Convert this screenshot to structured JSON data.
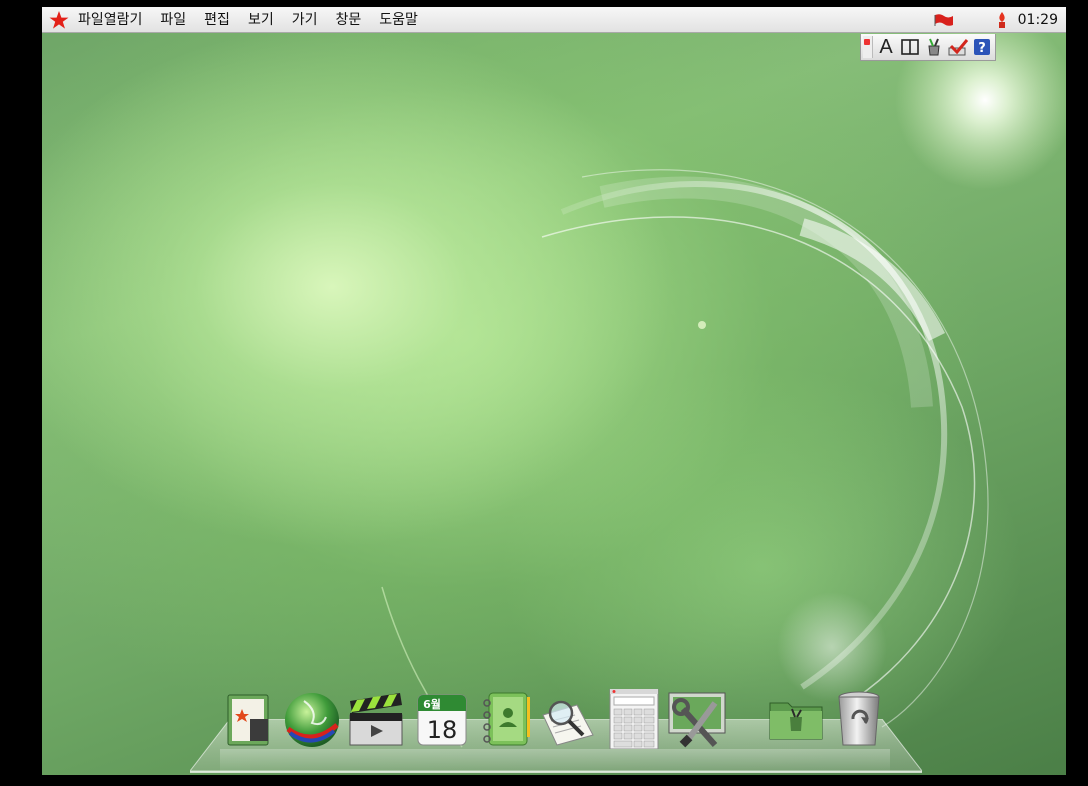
{
  "menubar": {
    "items": [
      "파일열람기",
      "파일",
      "편집",
      "보기",
      "가기",
      "창문",
      "도움말"
    ],
    "clock": "01:29",
    "star_color": "#e32018",
    "flag_color": "#d22"
  },
  "input_panel": {
    "items": [
      {
        "name": "text-tool-icon",
        "glyph": "A"
      },
      {
        "name": "book-icon",
        "glyph": "◫"
      },
      {
        "name": "brush-cup-icon",
        "glyph": "✎"
      },
      {
        "name": "keyboard-pen-icon",
        "glyph": "✓"
      },
      {
        "name": "help-icon",
        "glyph": "?"
      }
    ]
  },
  "dock": {
    "items": [
      {
        "name": "photo-viewer-icon"
      },
      {
        "name": "web-browser-icon"
      },
      {
        "name": "video-player-icon"
      },
      {
        "name": "calendar-icon",
        "month": "6월",
        "day": "18"
      },
      {
        "name": "address-book-icon"
      },
      {
        "name": "document-search-icon"
      },
      {
        "name": "calculator-icon"
      },
      {
        "name": "settings-tools-icon"
      },
      {
        "name": "file-manager-folder-icon"
      },
      {
        "name": "trash-icon"
      }
    ]
  }
}
